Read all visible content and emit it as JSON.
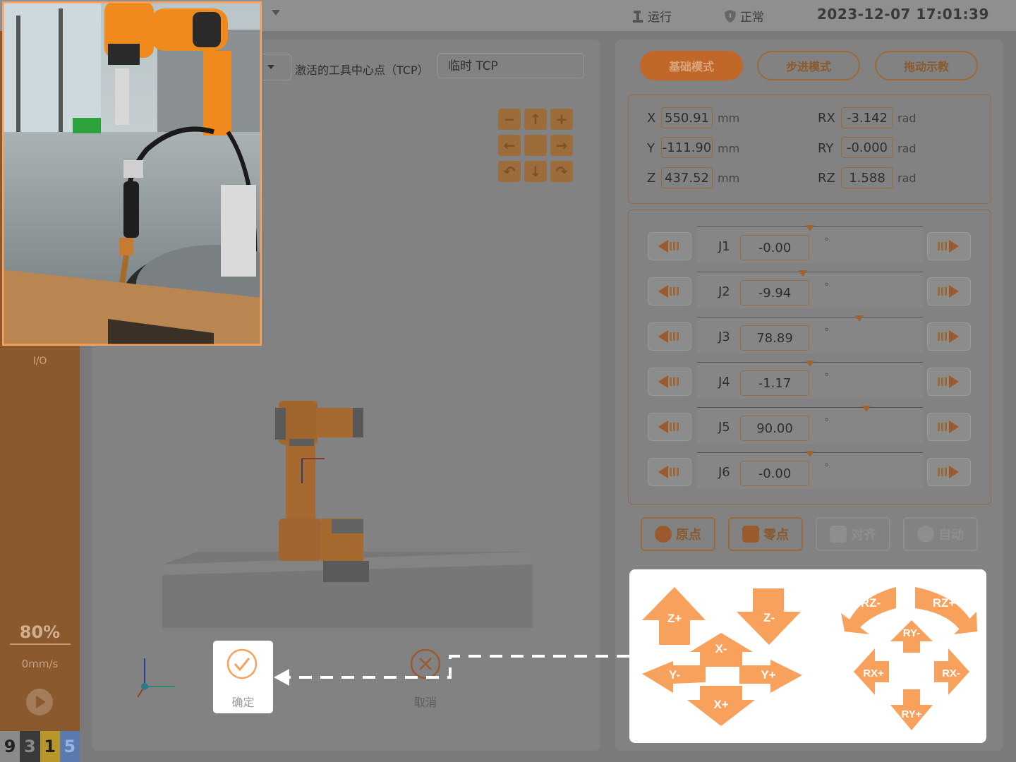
{
  "topbar": {
    "run_status": "运行",
    "safety_status": "正常",
    "datetime": "2023-12-07 17:01:39"
  },
  "sidebar": {
    "io_label": "I/O",
    "speed_percent": "80%",
    "speed_mmps": "0mm/s",
    "digits": [
      "9",
      "3",
      "1",
      "5"
    ]
  },
  "tcp": {
    "label": "激活的工具中心点（TCP）",
    "value": "临时 TCP"
  },
  "dialog": {
    "confirm": "确定",
    "cancel": "取消"
  },
  "modes": {
    "basic": "基础模式",
    "step": "步进模式",
    "drag": "拖动示教"
  },
  "pose": {
    "x_label": "X",
    "x": "550.91",
    "x_unit": "mm",
    "y_label": "Y",
    "y": "-111.90",
    "y_unit": "mm",
    "z_label": "Z",
    "z": "437.52",
    "z_unit": "mm",
    "rx_label": "RX",
    "rx": "-3.142",
    "rx_unit": "rad",
    "ry_label": "RY",
    "ry": "-0.000",
    "ry_unit": "rad",
    "rz_label": "RZ",
    "rz": "1.588",
    "rz_unit": "rad"
  },
  "joints": [
    {
      "name": "J1",
      "value": "-0.00",
      "unit": "°",
      "fraction": 0.5
    },
    {
      "name": "J2",
      "value": "-9.94",
      "unit": "°",
      "fraction": 0.47
    },
    {
      "name": "J3",
      "value": "78.89",
      "unit": "°",
      "fraction": 0.72
    },
    {
      "name": "J4",
      "value": "-1.17",
      "unit": "°",
      "fraction": 0.5
    },
    {
      "name": "J5",
      "value": "90.00",
      "unit": "°",
      "fraction": 0.75
    },
    {
      "name": "J6",
      "value": "-0.00",
      "unit": "°",
      "fraction": 0.5
    }
  ],
  "actions": {
    "home": "原点",
    "zero": "零点",
    "align": "对齐",
    "auto": "自动"
  },
  "jog": {
    "z_plus": "Z+",
    "z_minus": "Z-",
    "x_plus": "X+",
    "x_minus": "X-",
    "y_plus": "Y+",
    "y_minus": "Y-",
    "rz_plus": "RZ+",
    "rz_minus": "RZ-",
    "rx_plus": "RX+",
    "rx_minus": "RX-",
    "ry_plus": "RY+",
    "ry_minus": "RY-"
  },
  "colors": {
    "accent": "#f7a15c",
    "active_mode": "#c0682a",
    "sidebar": "#8a5a2e",
    "digit_backgrounds": [
      "#8a8a8a",
      "#3a3a3a",
      "#b8962a",
      "#5a7ab0"
    ],
    "digit_colors": [
      "#222222",
      "#888888",
      "#222222",
      "#9ab3dd"
    ]
  }
}
